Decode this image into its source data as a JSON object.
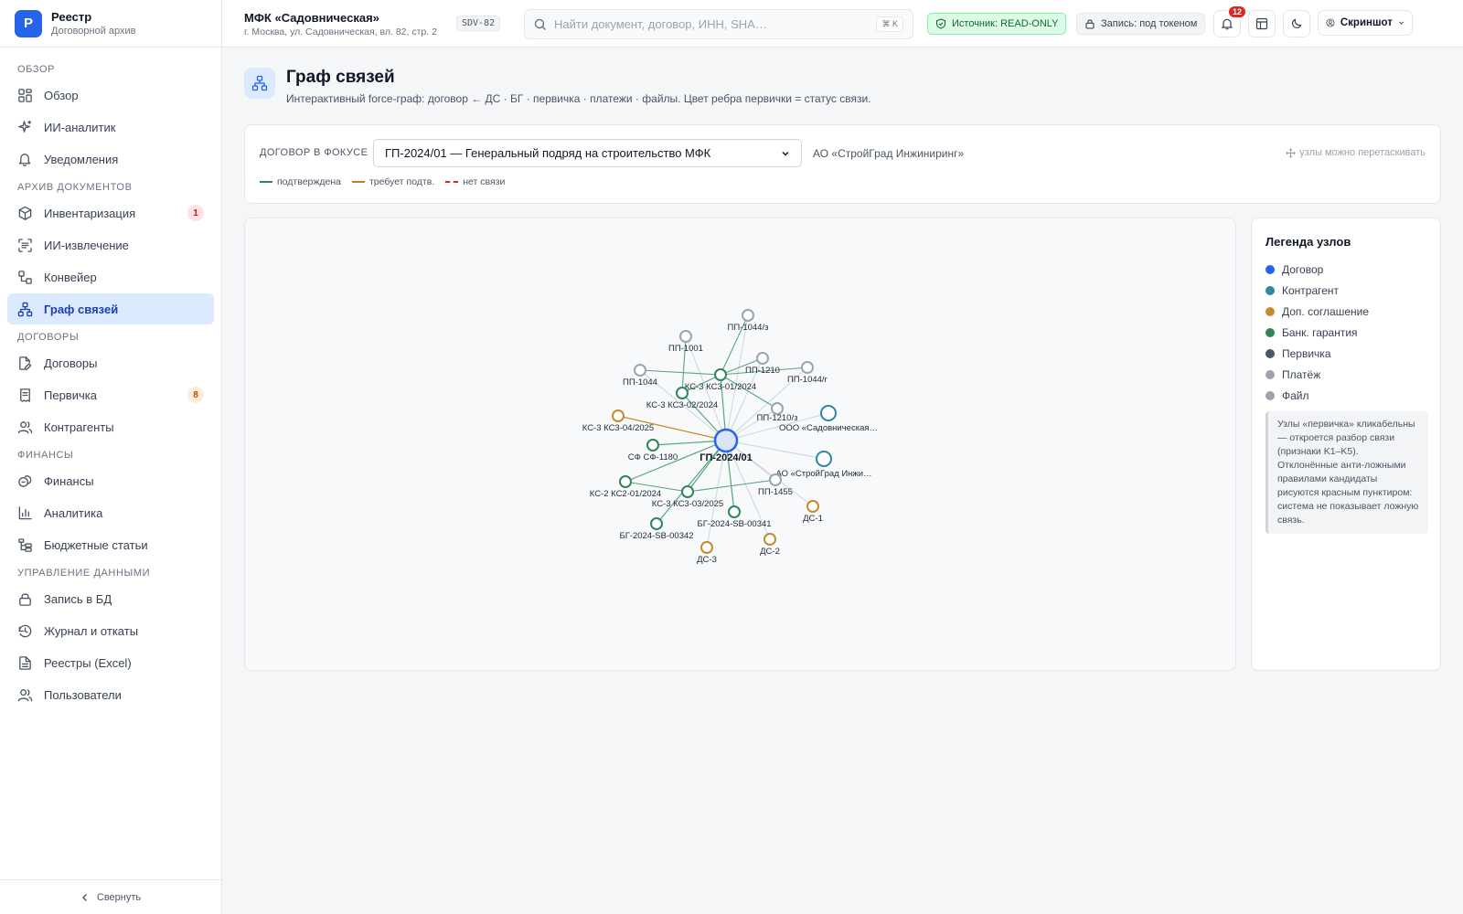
{
  "brand": {
    "logo": "Р",
    "title": "Реестр",
    "subtitle": "Договорной архив"
  },
  "sidebar": {
    "sections": [
      {
        "title": "ОБЗОР",
        "items": [
          {
            "label": "Обзор",
            "icon": "grid-icon"
          },
          {
            "label": "ИИ-аналитик",
            "icon": "sparkles-icon"
          },
          {
            "label": "Уведомления",
            "icon": "bell-icon"
          }
        ]
      },
      {
        "title": "АРХИВ ДОКУМЕНТОВ",
        "items": [
          {
            "label": "Инвентаризация",
            "icon": "package-icon",
            "badge": "1",
            "badge_color": "red"
          },
          {
            "label": "ИИ-извлечение",
            "icon": "scan-icon"
          },
          {
            "label": "Конвейер",
            "icon": "workflow-icon"
          },
          {
            "label": "Граф связей",
            "icon": "network-icon",
            "active": true
          }
        ]
      },
      {
        "title": "ДОГОВОРЫ",
        "items": [
          {
            "label": "Договоры",
            "icon": "file-edit-icon"
          },
          {
            "label": "Первичка",
            "icon": "receipt-icon",
            "badge": "8",
            "badge_color": "orange"
          },
          {
            "label": "Контрагенты",
            "icon": "users-icon"
          }
        ]
      },
      {
        "title": "ФИНАНСЫ",
        "items": [
          {
            "label": "Финансы",
            "icon": "coins-icon"
          },
          {
            "label": "Аналитика",
            "icon": "bar-chart-icon"
          },
          {
            "label": "Бюджетные статьи",
            "icon": "tree-icon"
          }
        ]
      },
      {
        "title": "УПРАВЛЕНИЕ ДАННЫМИ",
        "items": [
          {
            "label": "Запись в БД",
            "icon": "lock-icon"
          },
          {
            "label": "Журнал и откаты",
            "icon": "history-icon"
          },
          {
            "label": "Реестры (Excel)",
            "icon": "spreadsheet-icon"
          },
          {
            "label": "Пользователи",
            "icon": "users-icon"
          }
        ]
      }
    ],
    "collapse_label": "Свернуть"
  },
  "header": {
    "project_title": "МФК «Садовническая»",
    "project_address": "г. Москва, ул. Садовническая, вл. 82, стр. 2",
    "project_code": "SDV-82",
    "search_placeholder": "Найти документ, договор, ИНН, SHA…",
    "search_shortcut": "⌘ K",
    "source_badge": "Источник: READ-ONLY",
    "write_badge": "Запись: под токеном",
    "notifications_count": "12",
    "user_label": "Скриншот"
  },
  "page": {
    "title": "Граф связей",
    "subtitle": "Интерактивный force-граф: договор ← ДС · БГ · первичка · платежи · файлы. Цвет ребра первички = статус связи."
  },
  "focus": {
    "label": "ДОГОВОР В ФОКУСЕ",
    "selected": "ГП-2024/01 — Генеральный подряд на строительство МФК",
    "counterparty": "АО «СтройГрад Инжиниринг»",
    "drag_hint": "узлы можно перетаскивать",
    "edge_legend": [
      {
        "label": "подтверждена",
        "color": "#2f855a",
        "dashed": false
      },
      {
        "label": "требует подтв.",
        "color": "#c27c2c",
        "dashed": false
      },
      {
        "label": "нет связи",
        "color": "#dc2626",
        "dashed": true
      }
    ]
  },
  "legend": {
    "title": "Легенда узлов",
    "items": [
      {
        "label": "Договор",
        "color": "#2563eb"
      },
      {
        "label": "Контрагент",
        "color": "#2c89a3"
      },
      {
        "label": "Доп. соглашение",
        "color": "#c68a2e"
      },
      {
        "label": "Банк. гарантия",
        "color": "#2f855a"
      },
      {
        "label": "Первичка",
        "color": "#4b5563"
      },
      {
        "label": "Платёж",
        "color": "#9ca3af"
      },
      {
        "label": "Файл",
        "color": "#9ca3af"
      }
    ],
    "note": "Узлы «первичка» кликабельны — откроется разбор связи (признаки K1–K5). Отклонённые анти-ложными правилами кандидаты рисуются красным пунктиром: система не показывает ложную связь."
  },
  "graph": {
    "center": {
      "label": "ГП-2024/01",
      "type": "contract"
    },
    "nodes": [
      {
        "label": "ПП-1044/з",
        "type": "payment"
      },
      {
        "label": "ПП-1001",
        "type": "payment"
      },
      {
        "label": "ПП-1210",
        "type": "payment"
      },
      {
        "label": "ПП-1044/г",
        "type": "payment"
      },
      {
        "label": "ПП-1044",
        "type": "payment"
      },
      {
        "label": "КС-3 КС3-01/2024",
        "type": "primary"
      },
      {
        "label": "КС-3 КС3-02/2024",
        "type": "primary"
      },
      {
        "label": "ПП-1210/з",
        "type": "payment"
      },
      {
        "label": "ООО «Садовническая…",
        "type": "counterparty"
      },
      {
        "label": "КС-3 КС3-04/2025",
        "type": "addendum"
      },
      {
        "label": "СФ СФ-1180",
        "type": "primary"
      },
      {
        "label": "АО «СтройГрад Инжи…",
        "type": "counterparty"
      },
      {
        "label": "ПП-1455",
        "type": "payment"
      },
      {
        "label": "КС-2 КС2-01/2024",
        "type": "primary"
      },
      {
        "label": "КС-3 КС3-03/2025",
        "type": "primary"
      },
      {
        "label": "ДС-1",
        "type": "addendum"
      },
      {
        "label": "БГ-2024-SB-00341",
        "type": "guarantee"
      },
      {
        "label": "БГ-2024-SB-00342",
        "type": "guarantee"
      },
      {
        "label": "ДС-2",
        "type": "addendum"
      },
      {
        "label": "ДС-3",
        "type": "addendum"
      }
    ]
  }
}
